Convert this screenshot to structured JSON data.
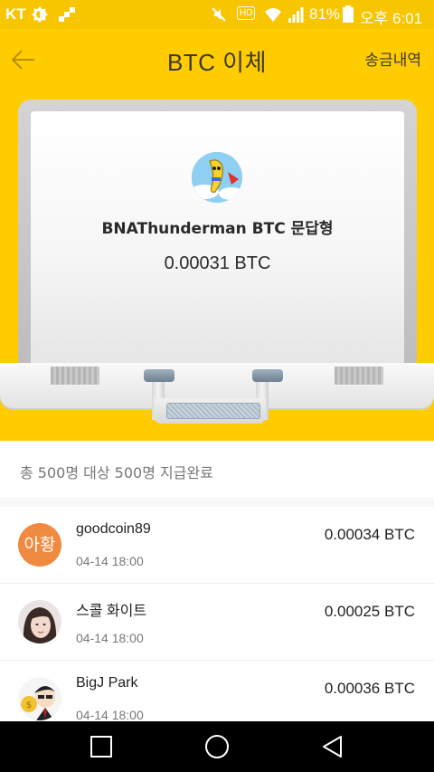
{
  "status_bar": {
    "carrier": "KT",
    "battery": "81%",
    "clock": "오후 6:01",
    "hd_label": "HD"
  },
  "header": {
    "title": "BTC  이체",
    "history_label": "송금내역"
  },
  "transfer": {
    "channel_name": "BNAThunderman  BTC  문답형",
    "total_amount": "0.00031   BTC"
  },
  "summary": {
    "text": "총 500명 대상 500명 지급완료"
  },
  "recipients": [
    {
      "avatar_text": "아황",
      "name": "goodcoin89",
      "time": "04-14 18:00",
      "amount": "0.00034 BTC"
    },
    {
      "avatar_text": "",
      "name": "스콜 화이트",
      "time": "04-14 18:00",
      "amount": "0.00025 BTC"
    },
    {
      "avatar_text": "",
      "name": "BigJ Park",
      "time": "04-14 18:00",
      "amount": "0.00036 BTC"
    }
  ],
  "colors": {
    "status_bar": "#f7c600",
    "header_bg": "#ffcc00",
    "text_avatar": "#f08a40"
  },
  "icons": {
    "back": "arrow-left-icon",
    "nav_recents": "square-icon",
    "nav_home": "circle-icon",
    "nav_back": "triangle-icon"
  }
}
